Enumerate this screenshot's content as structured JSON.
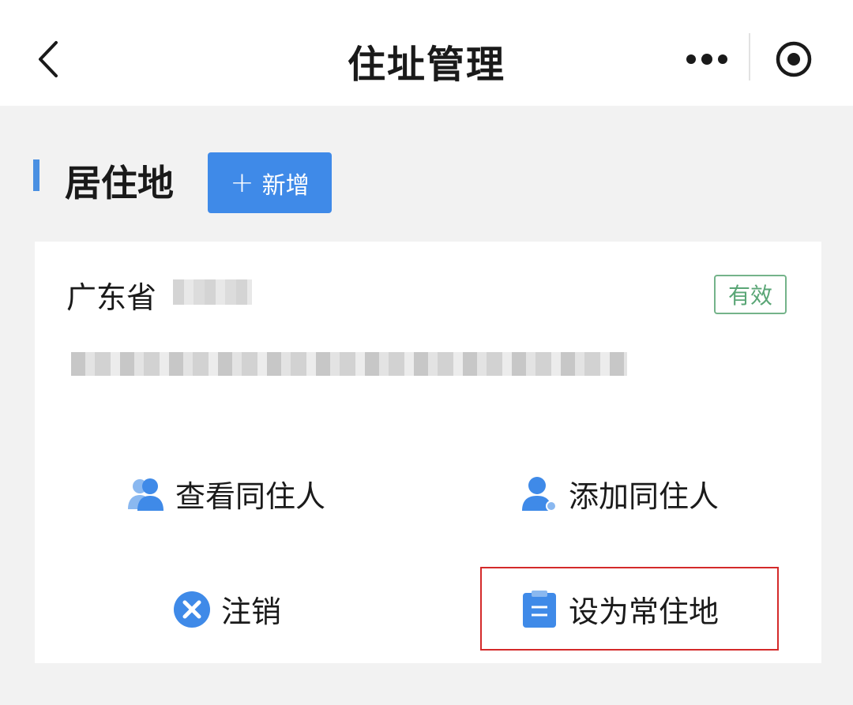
{
  "navbar": {
    "back_icon": "chevron-left-icon",
    "title": "住址管理",
    "more_icon": "more-dots-icon",
    "target_icon": "target-icon"
  },
  "section": {
    "title": "居住地",
    "add_button": {
      "icon": "plus-icon",
      "label": "新增"
    }
  },
  "card": {
    "province": "广东省",
    "status": "有效",
    "status_color": "#5aa676",
    "actions": {
      "view_cohabitants": {
        "icon": "people-icon",
        "label": "查看同住人"
      },
      "add_cohabitant": {
        "icon": "add-person-icon",
        "label": "添加同住人"
      },
      "cancel": {
        "icon": "close-circle-icon",
        "label": "注销"
      },
      "set_permanent": {
        "icon": "clipboard-icon",
        "label": "设为常住地"
      }
    }
  },
  "colors": {
    "accent": "#3f8ae8",
    "highlight_border": "#d42a2a"
  }
}
